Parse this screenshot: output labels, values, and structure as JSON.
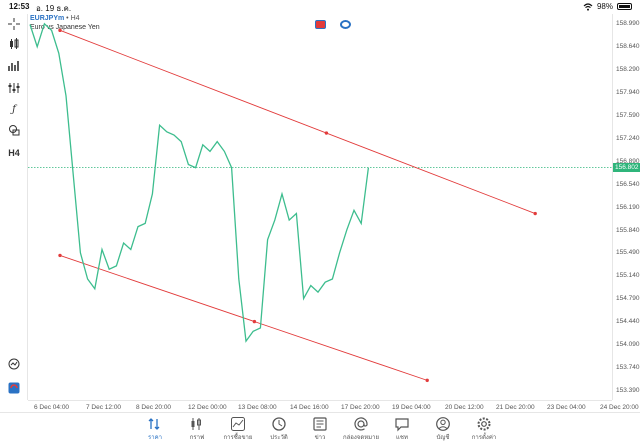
{
  "status_bar": {
    "time": "12:53",
    "date": "อ. 19 ธ.ค.",
    "battery": "98%"
  },
  "symbol": {
    "name": "EURJPYm",
    "separator": " • ",
    "timeframe": "H4",
    "description": "Euro vs Japanese Yen"
  },
  "left_toolbar": [
    {
      "name": "crosshair-icon",
      "glyph": "⌖"
    },
    {
      "name": "candles-icon",
      "glyph": ""
    },
    {
      "name": "bar-chart-icon",
      "glyph": ""
    },
    {
      "name": "indicators-icon",
      "glyph": ""
    },
    {
      "name": "function-icon",
      "glyph": "ƒ"
    },
    {
      "name": "objects-icon",
      "glyph": ""
    },
    {
      "name": "timeframe-label",
      "glyph": "H4"
    }
  ],
  "price_axis": {
    "labels": [
      "158.990",
      "158.640",
      "158.290",
      "157.940",
      "157.590",
      "157.240",
      "156.890",
      "156.540",
      "156.190",
      "155.840",
      "155.490",
      "155.140",
      "154.790",
      "154.440",
      "154.090",
      "153.740",
      "153.390"
    ],
    "current": "156.802",
    "current_value": 156.802,
    "range": [
      153.25,
      159.15
    ]
  },
  "time_axis": {
    "labels": [
      "6 Dec 04:00",
      "7 Dec 12:00",
      "8 Dec 20:00",
      "12 Dec 00:00",
      "13 Dec 08:00",
      "14 Dec 16:00",
      "17 Dec 20:00",
      "19 Dec 04:00",
      "20 Dec 12:00",
      "21 Dec 20:00",
      "23 Dec 04:00",
      "24 Dec 20:00"
    ]
  },
  "chart_data": {
    "type": "line",
    "series": [
      {
        "values": [
          158.99,
          158.65,
          159.0,
          158.9,
          158.55,
          157.9,
          156.7,
          155.5,
          155.1,
          154.95,
          155.55,
          155.25,
          155.3,
          155.65,
          155.55,
          155.9,
          155.95,
          156.4,
          157.45,
          157.35,
          157.3,
          157.2,
          156.85,
          156.8,
          157.15,
          157.05,
          157.2,
          157.05,
          156.8,
          155.1,
          154.15,
          154.3,
          154.35,
          155.7,
          156.0,
          156.4,
          156.0,
          156.1,
          154.8,
          155.0,
          154.9,
          155.05,
          155.1,
          155.5,
          155.85,
          156.15,
          155.95,
          156.8
        ]
      }
    ],
    "trendlines": [
      {
        "from": [
          0,
          158.9
        ],
        "to": [
          66,
          156.1
        ],
        "color": "#e23b3b",
        "anchor_index": 37
      },
      {
        "from": [
          0,
          155.46
        ],
        "to": [
          51,
          153.55
        ],
        "color": "#e23b3b",
        "anchor_index": 27
      }
    ],
    "current_price_line": 156.802,
    "grid": false,
    "colors": {
      "line": "#3dbd8e",
      "trend": "#e23b3b",
      "current": "#2fb57b"
    }
  },
  "bottom_nav": [
    {
      "name": "nav-quotes",
      "label": "ราคา",
      "icon": "quotes-icon",
      "active": true
    },
    {
      "name": "nav-chart",
      "label": "กราฟ",
      "icon": "chart-icon",
      "active": false
    },
    {
      "name": "nav-trade",
      "label": "การซื้อขาย",
      "icon": "trade-icon",
      "active": false
    },
    {
      "name": "nav-history",
      "label": "ประวัติ",
      "icon": "history-icon",
      "active": false
    },
    {
      "name": "nav-news",
      "label": "ข่าว",
      "icon": "news-icon",
      "active": false
    },
    {
      "name": "nav-mailbox",
      "label": "กล่องจดหมาย",
      "icon": "mail-icon",
      "active": false
    },
    {
      "name": "nav-chat",
      "label": "แชท",
      "icon": "chat-icon",
      "active": false
    },
    {
      "name": "nav-accounts",
      "label": "บัญชี",
      "icon": "account-icon",
      "active": false
    },
    {
      "name": "nav-settings",
      "label": "การตั้งค่า",
      "icon": "settings-icon",
      "active": false
    }
  ]
}
